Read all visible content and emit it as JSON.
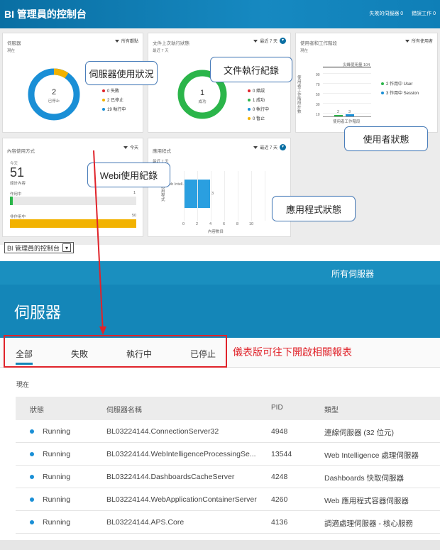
{
  "dashboard": {
    "title": "BI 管理員的控制台",
    "header_stats": [
      "失敗的伺服器 0",
      "錯誤工作 0"
    ],
    "servers_card": {
      "title": "伺服器",
      "filter": "所有觀點",
      "sub": "現在",
      "donut_center": "2",
      "donut_center_label": "已停止",
      "legend": [
        "0 失敗",
        "2 已停止",
        "19 執行中"
      ],
      "colors": {
        "failed": "#e0232a",
        "stopped": "#f2b200",
        "running": "#1a8fd6"
      }
    },
    "docs_card": {
      "title": "文件上次執行狀態",
      "filter": "最近 7 天",
      "sub": "最近 7 天",
      "donut_center": "1",
      "donut_center_label": "成功",
      "legend": [
        "0 錯誤",
        "1 成功",
        "0 執行中",
        "0 暫止"
      ]
    },
    "users_card": {
      "title": "使用者和工作階段",
      "filter": "所有使用者",
      "sub": "現在",
      "peak_label": "尖峰使用量 104",
      "y_ticks": [
        "90",
        "70",
        "50",
        "30",
        "10"
      ],
      "bar_labels": [
        "2",
        "3"
      ],
      "x_label": "使用者工作階段",
      "y_axis_label": "使用者工作階段計數",
      "legend": [
        "2 作用中 User",
        "3 作用中 Session"
      ]
    },
    "content_card": {
      "title": "內容使用方式",
      "filter": "今天",
      "sub": "今天",
      "big_number": "51",
      "big_label": "總計內容",
      "bar1_label": "作用中",
      "bar1_value": "1",
      "bar2_label": "非作用中",
      "bar2_value": "50"
    },
    "apps_card": {
      "title": "應用程式",
      "filter": "最近 7 天",
      "sub": "最近 7 天",
      "bar_category": "Web Intell...",
      "bar_value": "3",
      "x_ticks": [
        "0",
        "2",
        "4",
        "6",
        "8",
        "10"
      ],
      "x_label": "內容數目",
      "y_label": "應用程式"
    },
    "callouts": {
      "server_usage": "伺服器使用狀況",
      "doc_log": "文件執行紀錄",
      "user_status": "使用者狀態",
      "webi_log": "Webi使用紀錄",
      "app_status": "應用程式狀態"
    },
    "select_value": "BI 管理員的控制台"
  },
  "servers_page": {
    "all_servers": "所有伺服器",
    "heading": "伺服器",
    "tabs": [
      "全部",
      "失敗",
      "執行中",
      "已停止"
    ],
    "note": "儀表版可往下開啟相關報表",
    "now_label": "現在",
    "columns": [
      "狀態",
      "伺服器名稱",
      "PID",
      "類型"
    ],
    "rows": [
      {
        "status": "Running",
        "name": "BL03224144.ConnectionServer32",
        "pid": "4948",
        "type": "連線伺服器 (32 位元)"
      },
      {
        "status": "Running",
        "name": "BL03224144.WebIntelligenceProcessingSe...",
        "pid": "13544",
        "type": "Web Intelligence 處理伺服器"
      },
      {
        "status": "Running",
        "name": "BL03224144.DashboardsCacheServer",
        "pid": "4248",
        "type": "Dashboards 快取伺服器"
      },
      {
        "status": "Running",
        "name": "BL03224144.WebApplicationContainerServer",
        "pid": "4260",
        "type": "Web 應用程式容器伺服器"
      },
      {
        "status": "Running",
        "name": "BL03224144.APS.Core",
        "pid": "4136",
        "type": "調適處理伺服器 - 核心服務"
      }
    ]
  }
}
